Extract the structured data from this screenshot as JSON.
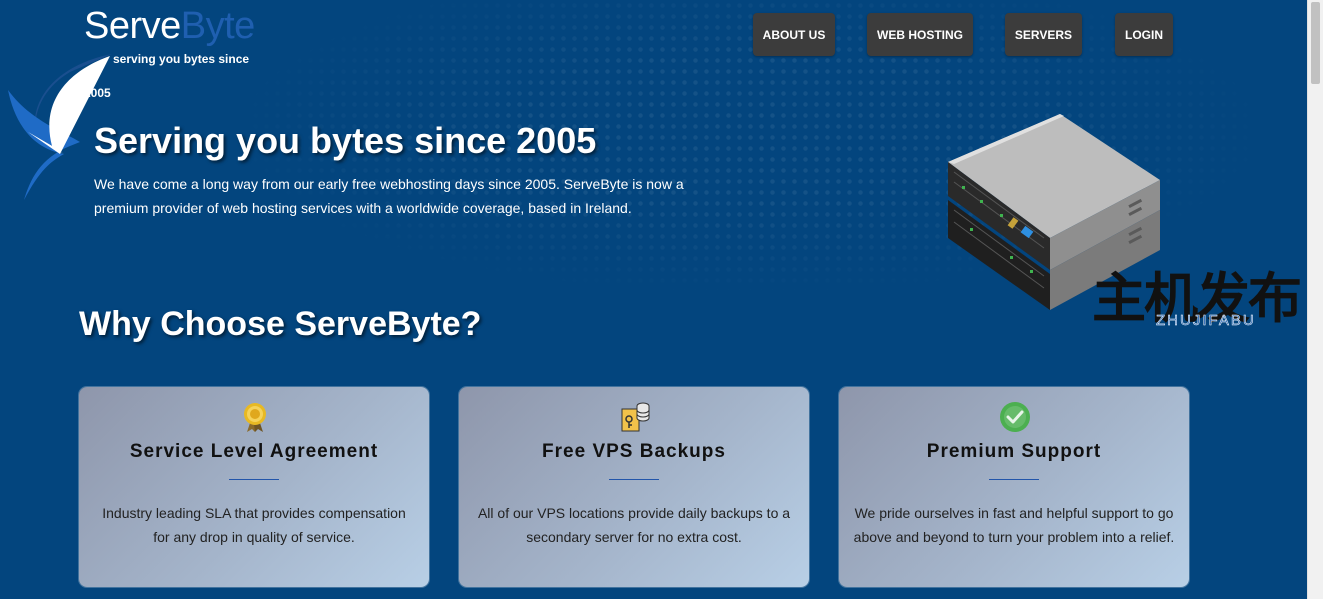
{
  "brand": {
    "part1": "Serve",
    "part2": "Byte",
    "tagline": "serving you bytes since",
    "tagline_year": "2005"
  },
  "nav": {
    "items": [
      {
        "label": "ABOUT US"
      },
      {
        "label": "WEB HOSTING"
      },
      {
        "label": "SERVERS"
      },
      {
        "label": "LOGIN"
      }
    ]
  },
  "hero": {
    "title": "Serving you bytes since 2005",
    "description": "We have come a long way from our early free webhosting days since 2005. ServeByte is now a premium provider of web hosting services with a worldwide coverage, based in Ireland."
  },
  "watermark": {
    "cn": "主机发布",
    "en": "ZHUJIFABU"
  },
  "section": {
    "title": "Why Choose ServeByte?"
  },
  "features": [
    {
      "icon": "award-medal-icon",
      "title": "Service Level Agreement",
      "description": "Industry leading SLA that provides compensation for any drop in quality of service."
    },
    {
      "icon": "backup-database-icon",
      "title": "Free VPS Backups",
      "description": "All of our VPS locations provide daily backups to a secondary server for no extra cost."
    },
    {
      "icon": "support-check-icon",
      "title": "Premium Support",
      "description": "We pride ourselves in fast and helpful support to go above and beyond to turn your problem into a relief."
    }
  ],
  "colors": {
    "background": "#03457e",
    "nav_button": "#3c3c3c",
    "brand_accent": "#1f5fb0",
    "card_gradient_start": "#8e96ab",
    "card_gradient_end": "#b8cfe6"
  }
}
